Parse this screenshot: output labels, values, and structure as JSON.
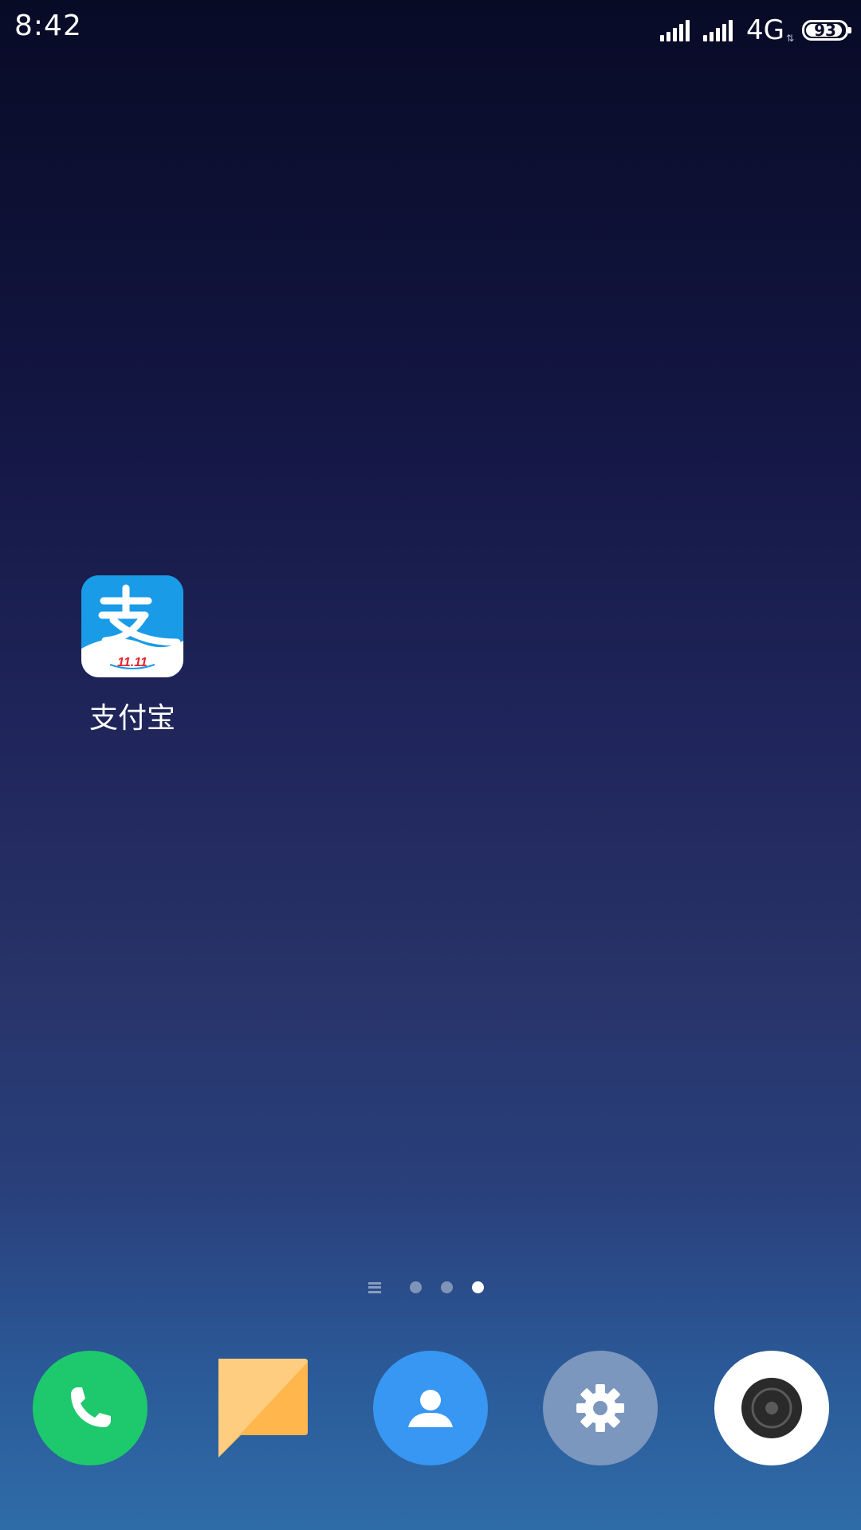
{
  "status_bar": {
    "time": "8:42",
    "network": "4G",
    "battery_percent": "93",
    "battery_level": 0.93,
    "signal_icons": [
      "signal-icon",
      "signal-icon"
    ]
  },
  "home": {
    "apps": [
      {
        "label": "支付宝",
        "icon": "alipay-icon",
        "badge": "11.11",
        "icon_color": "#1a9be8"
      }
    ]
  },
  "page_indicator": {
    "pages": 3,
    "current_page": 3
  },
  "dock": {
    "items": [
      {
        "name": "phone",
        "icon": "phone-icon",
        "color": "#1ec86c"
      },
      {
        "name": "messages",
        "icon": "message-icon",
        "color": "#ffbf5e"
      },
      {
        "name": "contacts",
        "icon": "contacts-icon",
        "color": "#3797f2"
      },
      {
        "name": "settings",
        "icon": "gear-icon",
        "color": "#7b97bd"
      },
      {
        "name": "camera",
        "icon": "camera-icon",
        "color": "#ffffff"
      }
    ]
  }
}
